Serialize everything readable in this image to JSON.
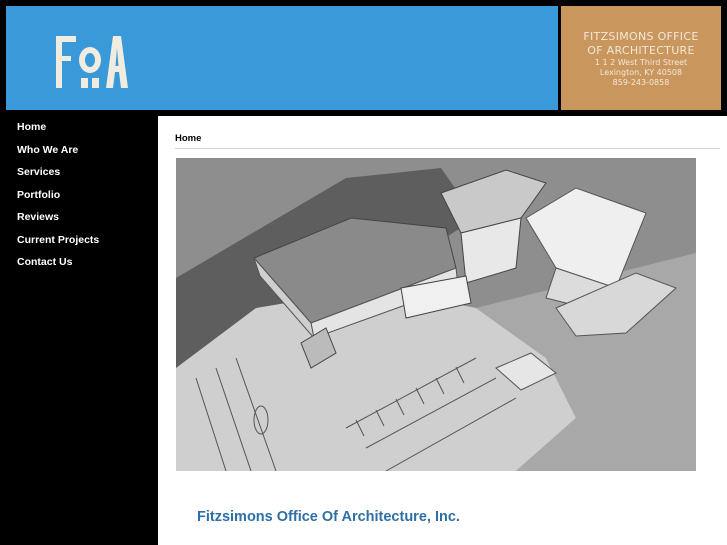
{
  "header": {
    "logo_text": "FOA",
    "firm_name_line1": "Fitzsimons Office",
    "firm_name_line2": "of Architecture",
    "address_line1": "1 1 2 West Third Street",
    "address_line2": "Lexington, KY 40508",
    "phone": "859-243-0858",
    "colors": {
      "blue_panel": "#3a9ad9",
      "tan_panel": "#c9965e",
      "logo_color": "#f0ece0"
    }
  },
  "nav": {
    "items": [
      {
        "label": "Home"
      },
      {
        "label": "Who We Are"
      },
      {
        "label": "Services"
      },
      {
        "label": "Portfolio"
      },
      {
        "label": "Reviews"
      },
      {
        "label": "Current Projects"
      },
      {
        "label": "Contact Us"
      }
    ]
  },
  "breadcrumb": {
    "current": "Home"
  },
  "hero": {
    "subject": "aerial-architectural-rendering"
  },
  "main": {
    "title": "Fitzsimons Office Of Architecture, Inc.",
    "title_color": "#2f6fa8"
  }
}
